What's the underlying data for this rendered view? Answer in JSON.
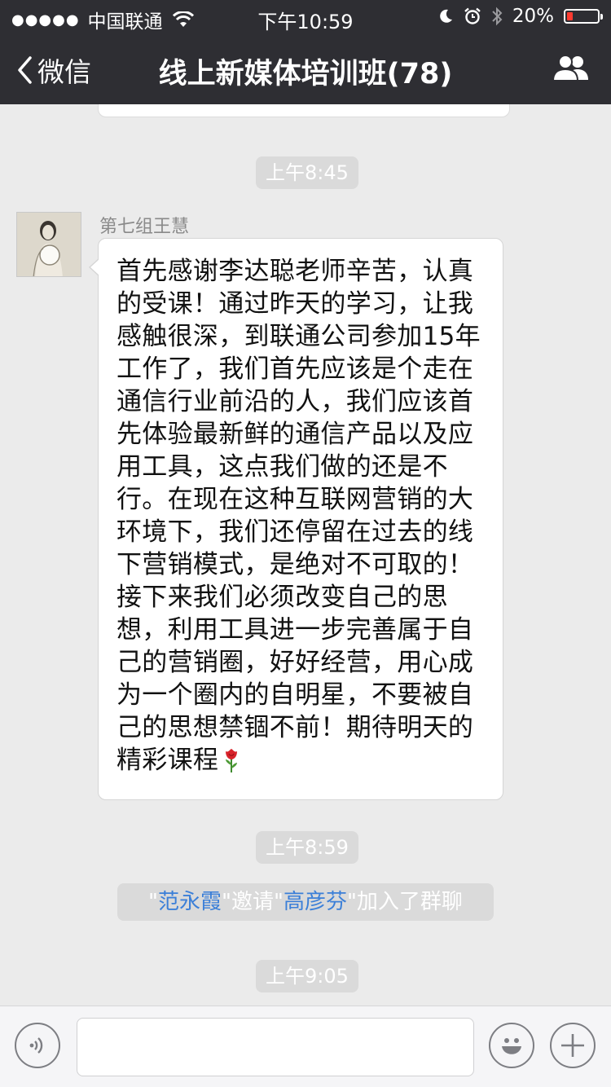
{
  "status_bar": {
    "signal_dots": "●●●●●",
    "carrier": "中国联通",
    "time": "下午10:59",
    "battery": "20%",
    "battery_level": 0.2,
    "battery_color": "#ff3b30"
  },
  "nav": {
    "back_label": "微信",
    "title": "线上新媒体培训班(78)",
    "right_icon": "group-members-icon"
  },
  "chat": {
    "times": [
      "上午8:45",
      "上午8:59",
      "上午9:05"
    ],
    "message": {
      "sender": "第七组王慧",
      "text": "首先感谢李达聪老师辛苦，认真的受课！通过昨天的学习，让我感触很深，到联通公司参加15年工作了，我们首先应该是个走在通信行业前沿的人，我们应该首先体验最新鲜的通信产品以及应用工具，这点我们做的还是不行。在现在这种互联网营销的大环境下，我们还停留在过去的线下营销模式，是绝对不可取的！接下来我们必须改变自己的思想，利用工具进一步完善属于自己的营销圈，好好经营，用心成为一个圈内的自明星，不要被自己的思想禁锢不前！期待明天的精彩课程",
      "emoji": "rose-icon"
    },
    "system": {
      "q1": "\"",
      "inviter": "范永霞",
      "q2": "\"邀请\"",
      "invitee": "高彦芬",
      "q3": "\"加入了群聊"
    }
  },
  "input_bar": {
    "voice_icon": "voice-icon",
    "text_value": "",
    "emoji_icon": "emoji-icon",
    "plus_icon": "plus-icon"
  },
  "colors": {
    "nav_bg": "#2e2e33",
    "chat_bg": "#ebebeb",
    "link_blue": "#3b7fd8"
  }
}
